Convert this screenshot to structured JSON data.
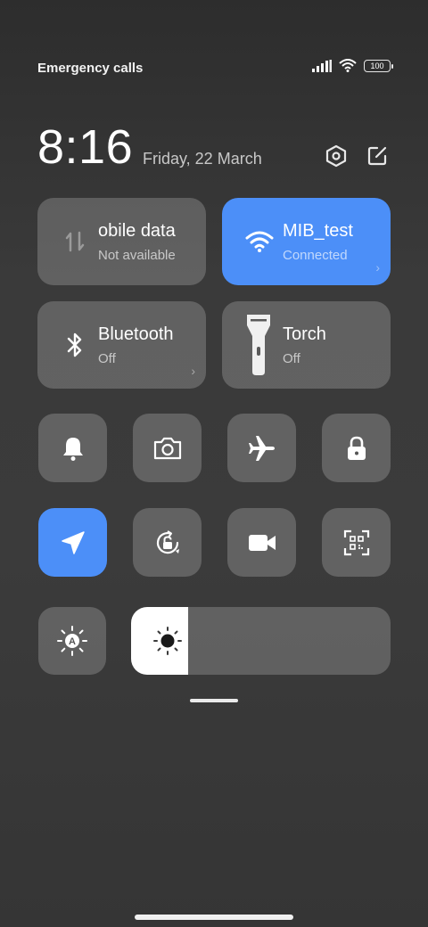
{
  "status_bar": {
    "carrier_text": "Emergency calls o",
    "battery_level": "100"
  },
  "header": {
    "time": "8:16",
    "date": "Friday, 22 March"
  },
  "tiles": [
    {
      "title": "obile data",
      "subtitle": "Not available",
      "icon": "mobile-data-arrows-icon",
      "active": false
    },
    {
      "title": "MIB_test",
      "subtitle": "Connected",
      "icon": "wifi-icon",
      "active": true
    },
    {
      "title": "Bluetooth",
      "subtitle": "Off",
      "icon": "bluetooth-icon",
      "active": false
    },
    {
      "title": "Torch",
      "subtitle": "Off",
      "icon": "torch-icon",
      "active": false
    }
  ],
  "toggles": [
    {
      "icon": "bell-icon",
      "active": false
    },
    {
      "icon": "camera-icon",
      "active": false
    },
    {
      "icon": "airplane-icon",
      "active": false
    },
    {
      "icon": "lock-icon",
      "active": false
    },
    {
      "icon": "location-icon",
      "active": true
    },
    {
      "icon": "rotation-lock-icon",
      "active": false
    },
    {
      "icon": "video-camera-icon",
      "active": false
    },
    {
      "icon": "qr-scanner-icon",
      "active": false
    }
  ],
  "brightness": {
    "level_fraction": 0.22,
    "auto_icon": "auto-brightness-icon"
  },
  "colors": {
    "accent": "#4c8ff8",
    "tile_bg": "rgba(255,255,255,0.2)",
    "background": "#333333"
  }
}
